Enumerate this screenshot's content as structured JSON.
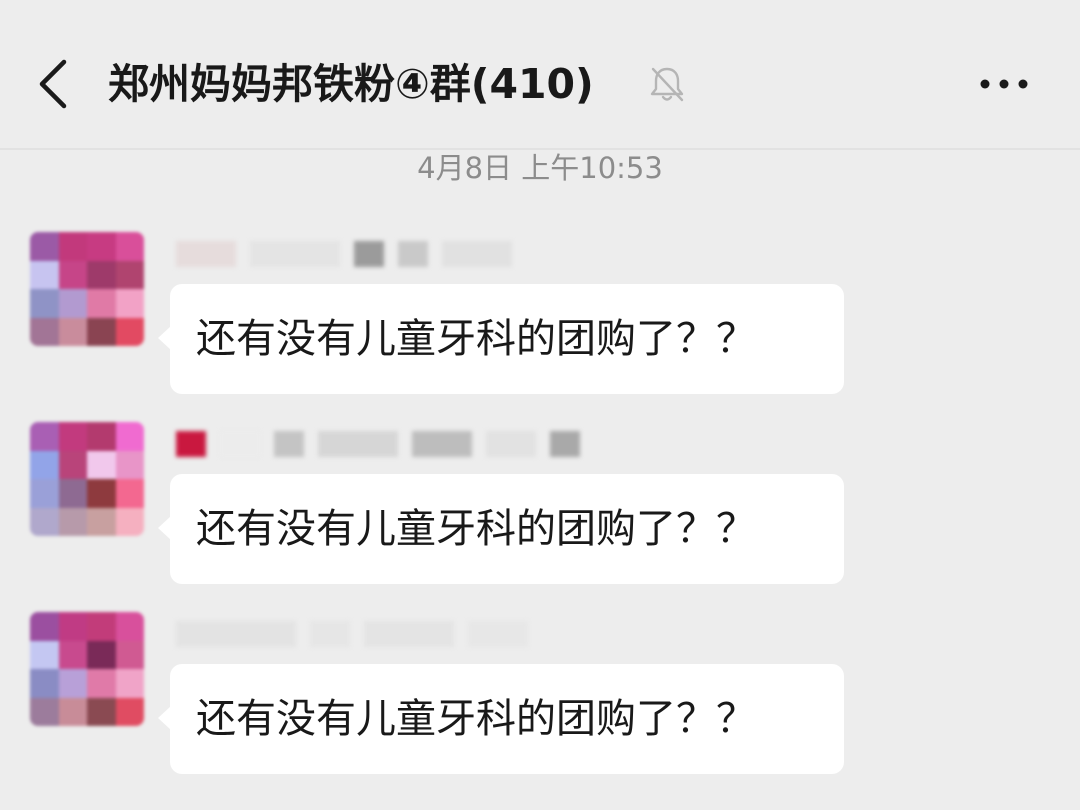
{
  "header": {
    "title": "郑州妈妈邦铁粉④群(410)",
    "back_icon": "chevron-left-icon",
    "mute_icon": "bell-off-icon",
    "more_icon": "more-horizontal-icon"
  },
  "timestamp": "4月8日 上午10:53",
  "messages": [
    {
      "text": "还有没有儿童牙科的团购了？？"
    },
    {
      "text": "还有没有儿童牙科的团购了？？"
    },
    {
      "text": "还有没有儿童牙科的团购了？？"
    }
  ],
  "colors": {
    "background": "#ededed",
    "bubble": "#ffffff",
    "text": "#191919",
    "muted_text": "#8c8c8c"
  }
}
